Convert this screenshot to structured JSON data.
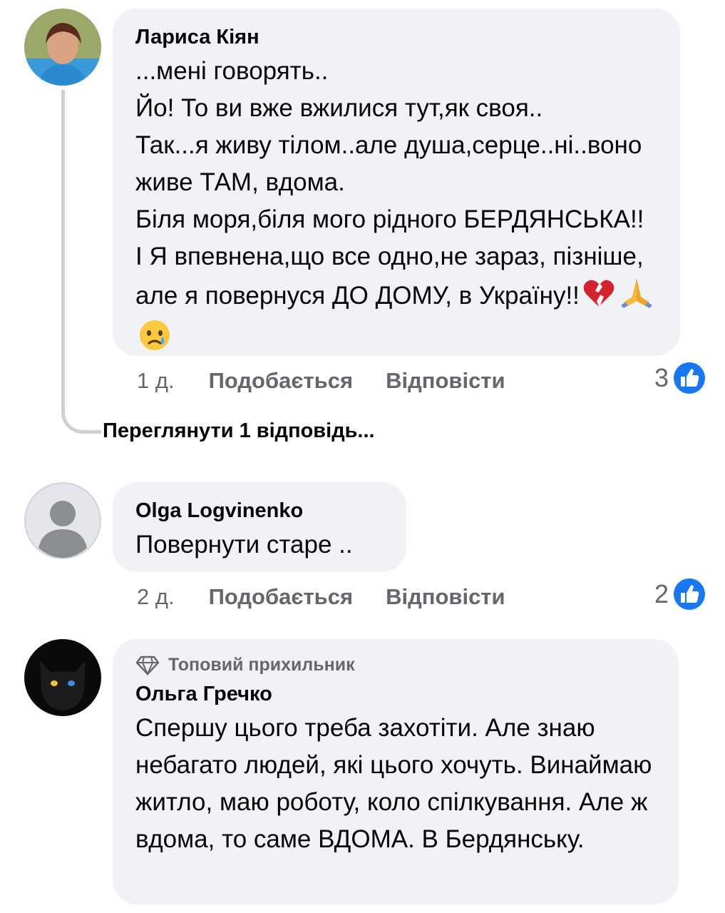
{
  "comments": [
    {
      "author": "Лариса Кіян",
      "text": "...мені говорять..\nЙо! То ви вже вжилися тут,як своя..\nТак...я живу тілом..але душа,серце..ні..воно живе ТАМ, вдома.\nБіля моря,біля мого рідного БЕРДЯНСЬКА!! І Я впевнена,що все одно,не зараз, пізніше, але я повернуся ДО ДОМУ, в Україну!!",
      "time": "1 д.",
      "like_label": "Подобається",
      "reply_label": "Відповісти",
      "reactions": "3",
      "emojis": [
        "broken-heart-icon",
        "pray-icon",
        "crying-face-icon"
      ]
    },
    {
      "author": "Olga Logvinenko",
      "text": "Повернути старе ..",
      "time": "2 д.",
      "like_label": "Подобається",
      "reply_label": "Відповісти",
      "reactions": "2"
    },
    {
      "badge": "Топовий прихильник",
      "author": "Ольга Гречко",
      "text": "Спершу цього треба захотіти. Але знаю небагато людей, які цього хочуть. Винаймаю житло, маю роботу, коло спілкування. Але ж вдома, то саме ВДОМА. В Бердянську."
    }
  ],
  "view_replies": "Переглянути 1 відповідь...",
  "colors": {
    "bubble": "#f0f2f5",
    "like_blue": "#1877f2",
    "meta_gray": "#65676b"
  }
}
